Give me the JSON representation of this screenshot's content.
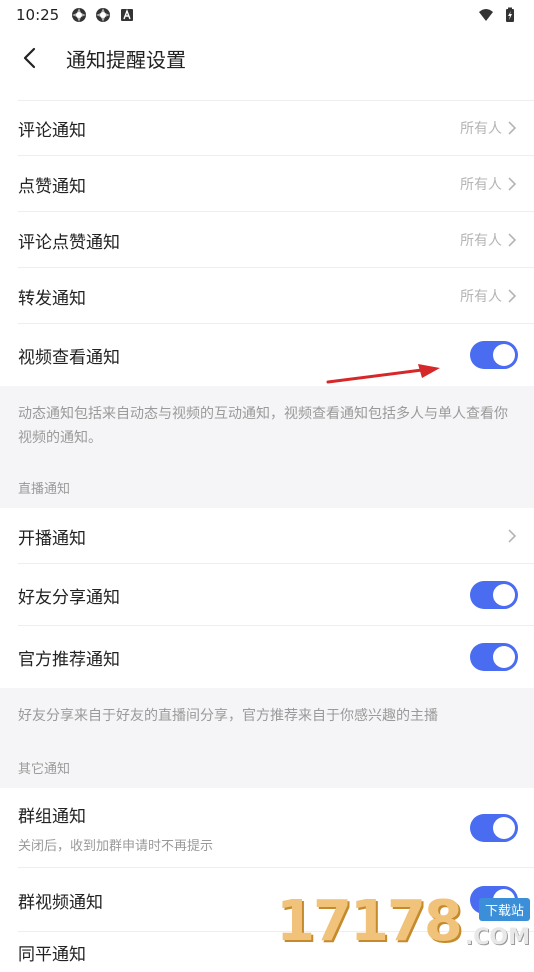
{
  "status_bar": {
    "time": "10:25"
  },
  "header": {
    "title": "通知提醒设置"
  },
  "dynamic_section": {
    "items": [
      {
        "label": "评论通知",
        "value": "所有人"
      },
      {
        "label": "点赞通知",
        "value": "所有人"
      },
      {
        "label": "评论点赞通知",
        "value": "所有人"
      },
      {
        "label": "转发通知",
        "value": "所有人"
      }
    ],
    "video_view": {
      "label": "视频查看通知",
      "on": true
    },
    "note": "动态通知包括来自动态与视频的互动通知，视频查看通知包括多人与单人查看你视频的通知。"
  },
  "live_section": {
    "title": "直播通知",
    "start_live": {
      "label": "开播通知"
    },
    "friend_share": {
      "label": "好友分享通知",
      "on": true
    },
    "official_recommend": {
      "label": "官方推荐通知",
      "on": true
    },
    "note": "好友分享来自于好友的直播间分享，官方推荐来自于你感兴趣的主播"
  },
  "other_section": {
    "title": "其它通知",
    "group": {
      "label": "群组通知",
      "sub": "关闭后，收到加群申请时不再提示",
      "on": true
    },
    "group_video": {
      "label": "群视频通知",
      "on": true
    },
    "partial": {
      "label": "同平通知"
    }
  },
  "watermark": {
    "number": "17178",
    "tag": "下载站",
    "domain": ".COM"
  },
  "colors": {
    "toggle_on": "#4a6cf0",
    "background_gray": "#f5f5f7",
    "annotation_arrow": "#d62828"
  }
}
